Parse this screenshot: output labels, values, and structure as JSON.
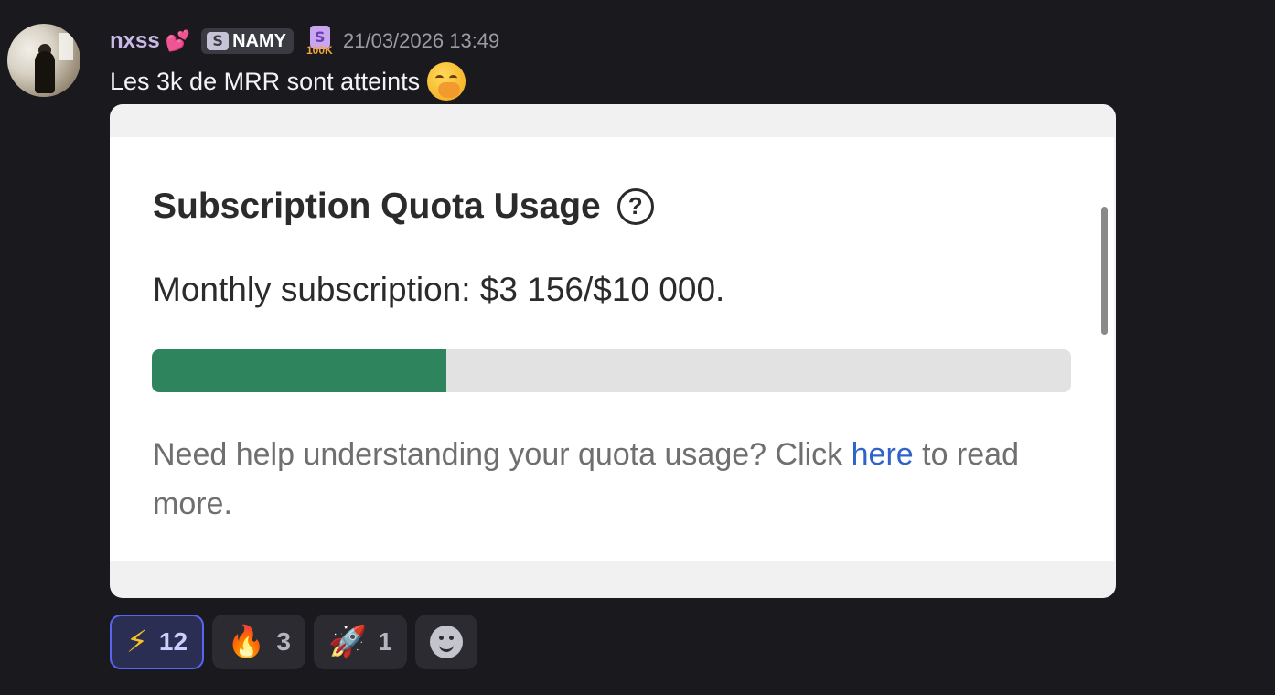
{
  "message": {
    "username": "nxss",
    "name_emoji": "💕",
    "tag_icon_glyph": "S",
    "tag_label": "NAMY",
    "badge_glyph": "S",
    "badge_count": "100K",
    "timestamp": "21/03/2026 13:49",
    "text": "Les 3k de MRR sont atteints",
    "text_emoji": "hand-over-mouth-face"
  },
  "embed": {
    "title": "Subscription Quota Usage",
    "help_icon_glyph": "?",
    "quota_line": "Monthly subscription: $3 156/$10 000.",
    "progress_percent": 32,
    "help_before": "Need help understanding your quota usage? Click ",
    "help_link": "here",
    "help_after": " to read more."
  },
  "reactions": [
    {
      "emoji": "⚡",
      "count": "12",
      "active": true
    },
    {
      "emoji": "🔥",
      "count": "3",
      "active": false
    },
    {
      "emoji": "🚀",
      "count": "1",
      "active": false
    }
  ],
  "colors": {
    "progress_fill": "#2e845c",
    "link": "#2f63c9",
    "username": "#c9b8e8"
  }
}
